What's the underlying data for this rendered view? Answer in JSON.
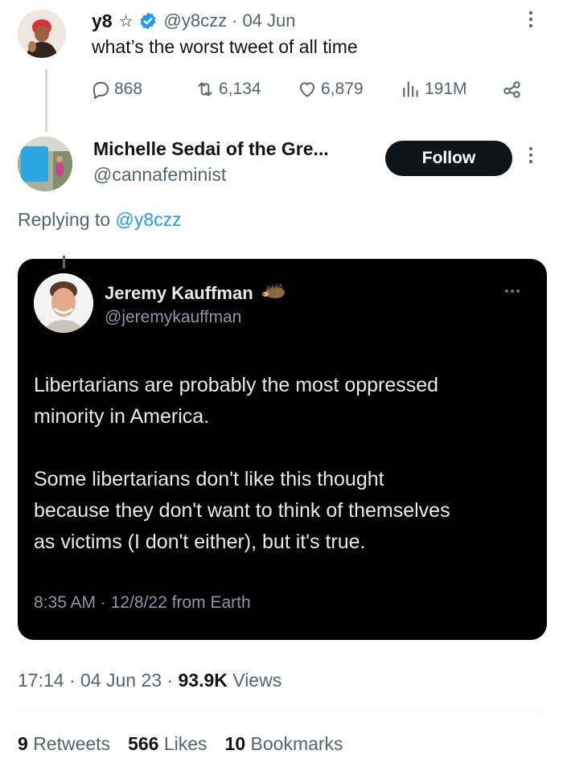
{
  "parent_tweet": {
    "name": "y8",
    "star_glyph": "☆",
    "handle": "@y8czz",
    "separator": "·",
    "date": "04 Jun",
    "text": "what’s the worst tweet of all time",
    "actions": {
      "replies": "868",
      "retweets": "6,134",
      "likes": "6,879",
      "views": "191M"
    }
  },
  "reply": {
    "name": "Michelle Sedai of the Gre...",
    "handle": "@cannafeminist",
    "follow_label": "Follow",
    "replying_prefix": "Replying to",
    "replying_handle": "@y8czz"
  },
  "embedded_image": {
    "name": "Jeremy Kauffman",
    "handle": "@jeremykauffman",
    "text_line1": "Libertarians are probably the most oppressed",
    "text_line2": "minority in America.",
    "text_line3": "Some libertarians don't like this thought",
    "text_line4": "because they don't want to think of themselves",
    "text_line5": "as victims (I don't either), but it's true.",
    "meta": "8:35 AM · 12/8/22 from Earth"
  },
  "footer": {
    "time": "17:14",
    "date": "04 Jun 23",
    "views_count": "93.9K",
    "views_label": "Views",
    "retweets_count": "9",
    "retweets_label": "Retweets",
    "likes_count": "566",
    "likes_label": "Likes",
    "bookmarks_count": "10",
    "bookmarks_label": "Bookmarks"
  },
  "colors": {
    "accent": "#1d9bf0",
    "text_primary": "#0f1419",
    "text_secondary": "#536471",
    "embed_bg": "#000000"
  },
  "icons": [
    "reply-icon",
    "retweet-icon",
    "like-icon",
    "views-icon",
    "share-icon",
    "verified-icon",
    "more-icon",
    "hedgehog-icon"
  ]
}
